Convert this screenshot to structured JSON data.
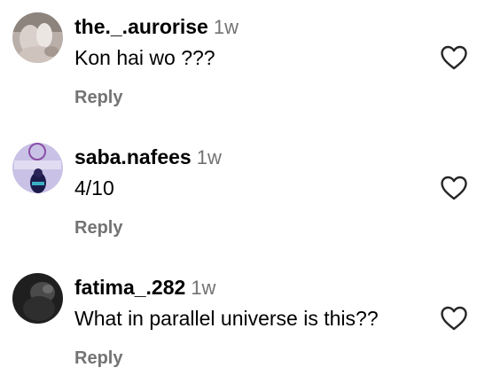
{
  "comments": [
    {
      "username": "the._.aurorise",
      "time": "1w",
      "text": "Kon hai wo ???",
      "reply_label": "Reply",
      "avatar_icon": "user-avatar-photo",
      "like_icon": "heart-outline-icon"
    },
    {
      "username": "saba.nafees",
      "time": "1w",
      "text": "4/10",
      "reply_label": "Reply",
      "avatar_icon": "user-avatar-photo",
      "like_icon": "heart-outline-icon"
    },
    {
      "username": "fatima_.282",
      "time": "1w",
      "text": "What in parallel universe is this??",
      "reply_label": "Reply",
      "avatar_icon": "user-avatar-photo",
      "like_icon": "heart-outline-icon"
    }
  ],
  "colors": {
    "text": "#000000",
    "secondary": "#737373",
    "background": "#ffffff"
  }
}
